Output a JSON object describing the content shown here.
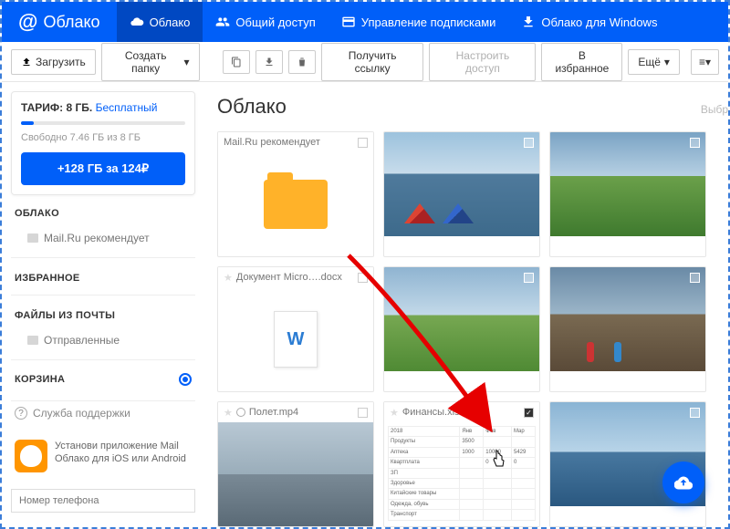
{
  "brand": "Облако",
  "nav": [
    {
      "label": "Облако",
      "icon": "cloud"
    },
    {
      "label": "Общий доступ",
      "icon": "people"
    },
    {
      "label": "Управление подписками",
      "icon": "card"
    },
    {
      "label": "Облако для Windows",
      "icon": "download"
    }
  ],
  "toolbar": {
    "upload": "Загрузить",
    "create_folder": "Создать папку",
    "get_link": "Получить ссылку",
    "configure_access": "Настроить доступ",
    "to_favorites": "В избранное",
    "more": "Ещё"
  },
  "sidebar": {
    "tariff_label": "ТАРИФ: 8 ГБ.",
    "tariff_badge": "Бесплатный",
    "tariff_sub": "Свободно 7.46 ГБ из 8 ГБ",
    "upgrade": "+128 ГБ за 124₽",
    "sec_cloud": "ОБЛАКО",
    "item_recommend": "Mail.Ru рекомендует",
    "sec_fav": "ИЗБРАННОЕ",
    "sec_mailfiles": "ФАЙЛЫ ИЗ ПОЧТЫ",
    "item_sent": "Отправленные",
    "sec_trash": "КОРЗИНА",
    "support": "Служба поддержки",
    "promo": "Установи приложение Mail Облако для iOS или Android",
    "phone_placeholder": "Номер телефона"
  },
  "page": {
    "title": "Облако",
    "hint": "Выбр"
  },
  "tiles": [
    {
      "type": "folder",
      "label": "Mail.Ru рекомендует"
    },
    {
      "type": "image-tents"
    },
    {
      "type": "image-green"
    },
    {
      "type": "doc",
      "label": "Документ Micro….docx"
    },
    {
      "type": "image-field"
    },
    {
      "type": "image-rocks"
    },
    {
      "type": "video",
      "label": "Полет.mp4"
    },
    {
      "type": "xlsx",
      "label": "Финансы.xlsx",
      "checked": true
    },
    {
      "type": "image-water"
    }
  ]
}
